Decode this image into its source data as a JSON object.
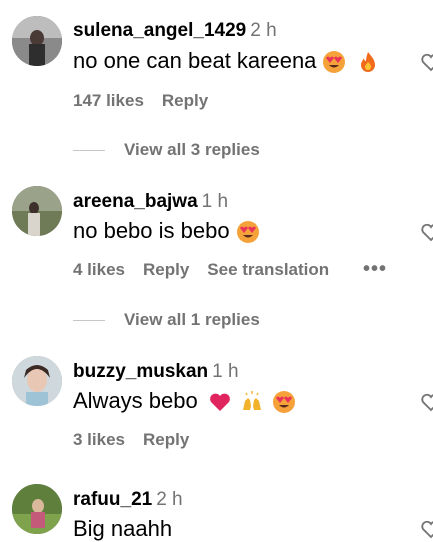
{
  "comments": [
    {
      "username": "sulena_angel_1429",
      "time": "2 h",
      "text": "no one can beat kareena",
      "emojis": [
        "heart-eyes-emoji",
        "fire-emoji"
      ],
      "likes": "147 likes",
      "reply": "Reply",
      "view_replies": "View all 3 replies"
    },
    {
      "username": "areena_bajwa",
      "time": "1 h",
      "text": "no bebo is bebo",
      "emojis": [
        "heart-eyes-emoji"
      ],
      "likes": "4 likes",
      "reply": "Reply",
      "see_translation": "See translation",
      "more": "•••",
      "view_replies": "View all 1 replies"
    },
    {
      "username": "buzzy_muskan",
      "time": "1 h",
      "text": "Always bebo",
      "emojis": [
        "red-heart-emoji",
        "raised-hands-emoji",
        "heart-eyes-emoji"
      ],
      "likes": "3 likes",
      "reply": "Reply"
    },
    {
      "username": "rafuu_21",
      "time": "2 h",
      "text": "Big naahh"
    }
  ],
  "icons": {
    "like": "heart-outline-icon"
  }
}
